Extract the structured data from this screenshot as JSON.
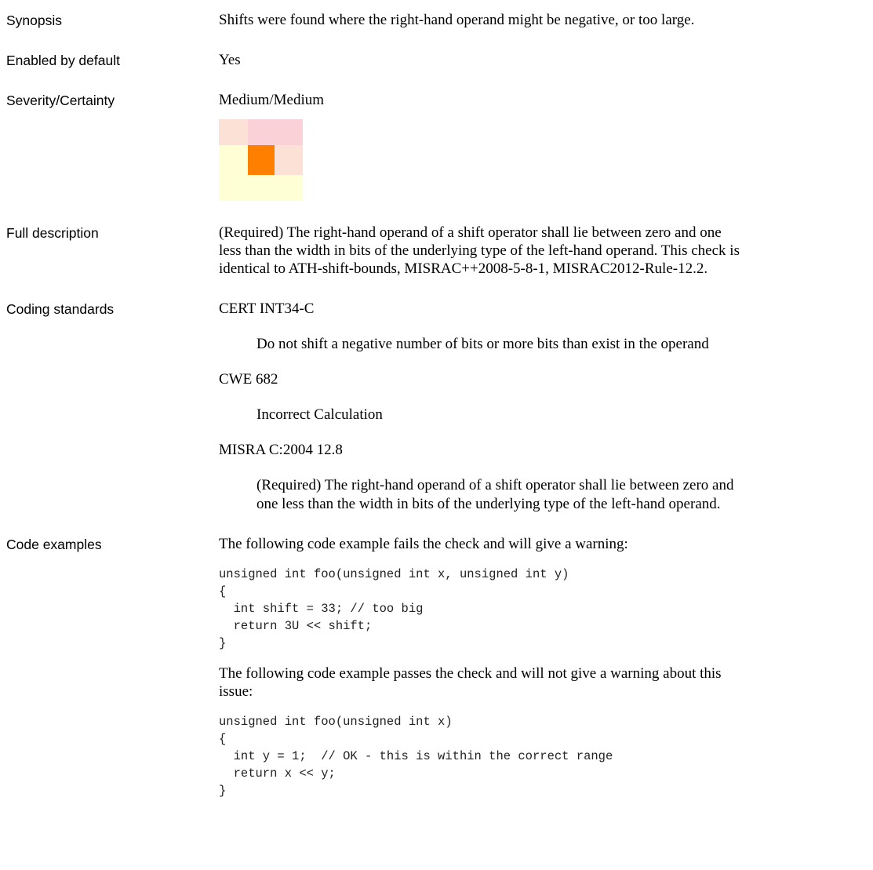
{
  "labels": {
    "synopsis": "Synopsis",
    "enabled": "Enabled by default",
    "severity": "Severity/Certainty",
    "full_description": "Full description",
    "coding_standards": "Coding standards",
    "code_examples": "Code examples"
  },
  "synopsis": "Shifts were found where the right-hand operand might be negative, or too large.",
  "enabled": "Yes",
  "severity": {
    "text": "Medium/Medium",
    "grid_colors": [
      [
        "#FCE2D6",
        "#FAD1D7",
        "#FAD1D7"
      ],
      [
        "#FFFFD6",
        "#FF7F00",
        "#FCE2D6"
      ],
      [
        "#FFFFD6",
        "#FFFFD6",
        "#FFFFD6"
      ]
    ]
  },
  "full_description": {
    "lines": [
      " (Required) The right-hand operand of a shift operator shall lie between zero and one",
      "less than the width in bits of the underlying type of the left-hand operand. This check is",
      "identical to ATH-shift-bounds, MISRAC++2008-5-8-1, MISRAC2012-Rule-12.2."
    ]
  },
  "coding_standards": [
    {
      "name": "CERT INT34-C",
      "description": [
        "Do not shift a negative number of bits or more bits than exist in the operand"
      ]
    },
    {
      "name": "CWE 682",
      "description": [
        "Incorrect Calculation"
      ]
    },
    {
      "name": "MISRA C:2004 12.8",
      "description": [
        "(Required) The right-hand operand of a shift operator shall lie between zero and",
        "one less than the width in bits of the underlying type of the left-hand operand."
      ]
    }
  ],
  "code_examples": {
    "fail_intro": "The following code example fails the check and will give a warning:",
    "fail_code": "unsigned int foo(unsigned int x, unsigned int y)\n{\n  int shift = 33; // too big\n  return 3U << shift;\n}",
    "pass_intro": [
      "The following code example passes the check and will not give a warning about this",
      "issue:"
    ],
    "pass_code": "unsigned int foo(unsigned int x)\n{\n  int y = 1;  // OK - this is within the correct range\n  return x << y;\n}"
  }
}
